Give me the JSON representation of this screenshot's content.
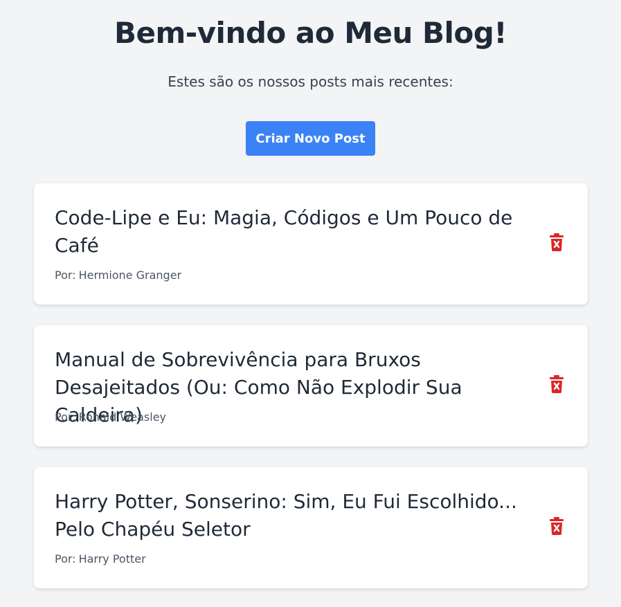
{
  "header": {
    "title": "Bem-vindo ao Meu Blog!",
    "subtitle": "Estes são os nossos posts mais recentes:"
  },
  "actions": {
    "new_post_label": "Criar Novo Post"
  },
  "posts": [
    {
      "title": "Code-Lipe e Eu: Magia, Códigos e Um Pouco de Café",
      "author_label": "Por:",
      "author": "Hermione Granger",
      "delete_icon": "trash-icon"
    },
    {
      "title": "Manual de Sobrevivência para Bruxos Desajeitados (Ou: Como Não Explodir Sua Caldeira)",
      "author_label": "Por:",
      "author": "Ronald Weasley",
      "delete_icon": "trash-icon"
    },
    {
      "title": "Harry Potter, Sonserino: Sim, Eu Fui Escolhido... Pelo Chapéu Seletor",
      "author_label": "Por:",
      "author": "Harry Potter",
      "delete_icon": "trash-icon"
    }
  ],
  "colors": {
    "background": "#f3f4f6",
    "primary": "#3b82f6",
    "danger": "#dc2626",
    "text": "#1f2937"
  }
}
